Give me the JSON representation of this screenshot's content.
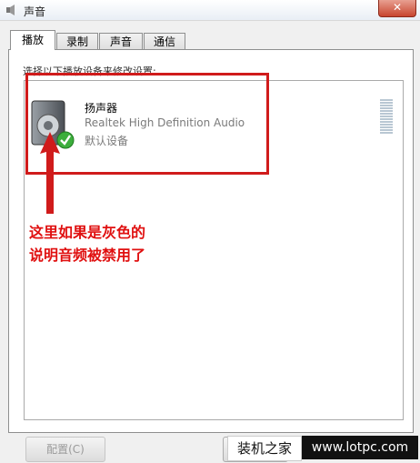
{
  "window": {
    "title": "声音",
    "close_label": "✕"
  },
  "tabs": [
    {
      "label": "播放",
      "active": true
    },
    {
      "label": "录制",
      "active": false
    },
    {
      "label": "声音",
      "active": false
    },
    {
      "label": "通信",
      "active": false
    }
  ],
  "instruction": "选择以下播放设备来修改设置:",
  "device": {
    "name": "扬声器",
    "description": "Realtek High Definition Audio",
    "status": "默认设备",
    "icon": "speaker-icon",
    "status_icon": "green-check-icon"
  },
  "annotation": {
    "line1": "这里如果是灰色的",
    "line2": "说明音频被禁用了",
    "color": "#e01010"
  },
  "buttons": {
    "configure": "配置(C)"
  },
  "watermark": {
    "brand": "装机之家",
    "url": "www.lotpc.com"
  },
  "colors": {
    "highlight": "#d01b1b",
    "close": "#c8452f"
  }
}
